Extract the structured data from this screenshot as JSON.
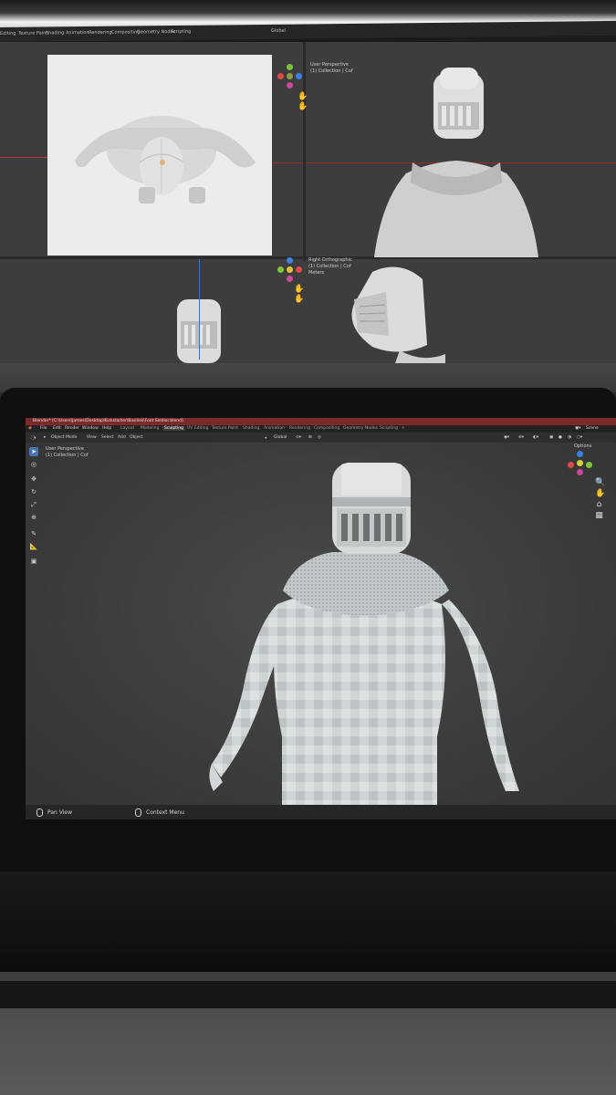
{
  "top_monitor": {
    "tabs": [
      "Editing",
      "Texture Paint",
      "Shading",
      "Animation",
      "Rendering",
      "Compositing",
      "Geometry Nodes",
      "Scripting"
    ],
    "transform_orientation": "Global",
    "viewport_top_right": {
      "view": "User Perspective",
      "collection": "(1) Collection | Cof"
    },
    "viewport_bottom": {
      "view": "Right Orthographic",
      "collection": "(1) Collection | Cof",
      "units": "Meters"
    }
  },
  "blender": {
    "title": "Blender* [C:\\Users\\James\\Desktop\\Kickstarter\\Basilisk\\Foot Soldier.blend]",
    "menu": [
      "File",
      "Edit",
      "Render",
      "Window",
      "Help"
    ],
    "workspaces": [
      "Layout",
      "Modeling",
      "Sculpting",
      "UV Editing",
      "Texture Paint",
      "Shading",
      "Animation",
      "Rendering",
      "Compositing",
      "Geometry Nodes",
      "Scripting",
      "+"
    ],
    "active_workspace": "Sculpting",
    "scene_label": "Scene",
    "header": {
      "mode": "Object Mode",
      "view": "View",
      "select": "Select",
      "add": "Add",
      "object": "Object",
      "orientation": "Global",
      "options": "Options"
    },
    "viewport": {
      "view": "User Perspective",
      "collection": "(1) Collection | Cof"
    },
    "status_bar": {
      "pan": "Pan View",
      "context": "Context Menu"
    }
  },
  "colors": {
    "title_bar": "#7a2a2a",
    "active_tool": "#4772b3",
    "axis_x": "#e04848",
    "axis_y": "#7ec43a",
    "axis_z": "#3f80e0"
  }
}
